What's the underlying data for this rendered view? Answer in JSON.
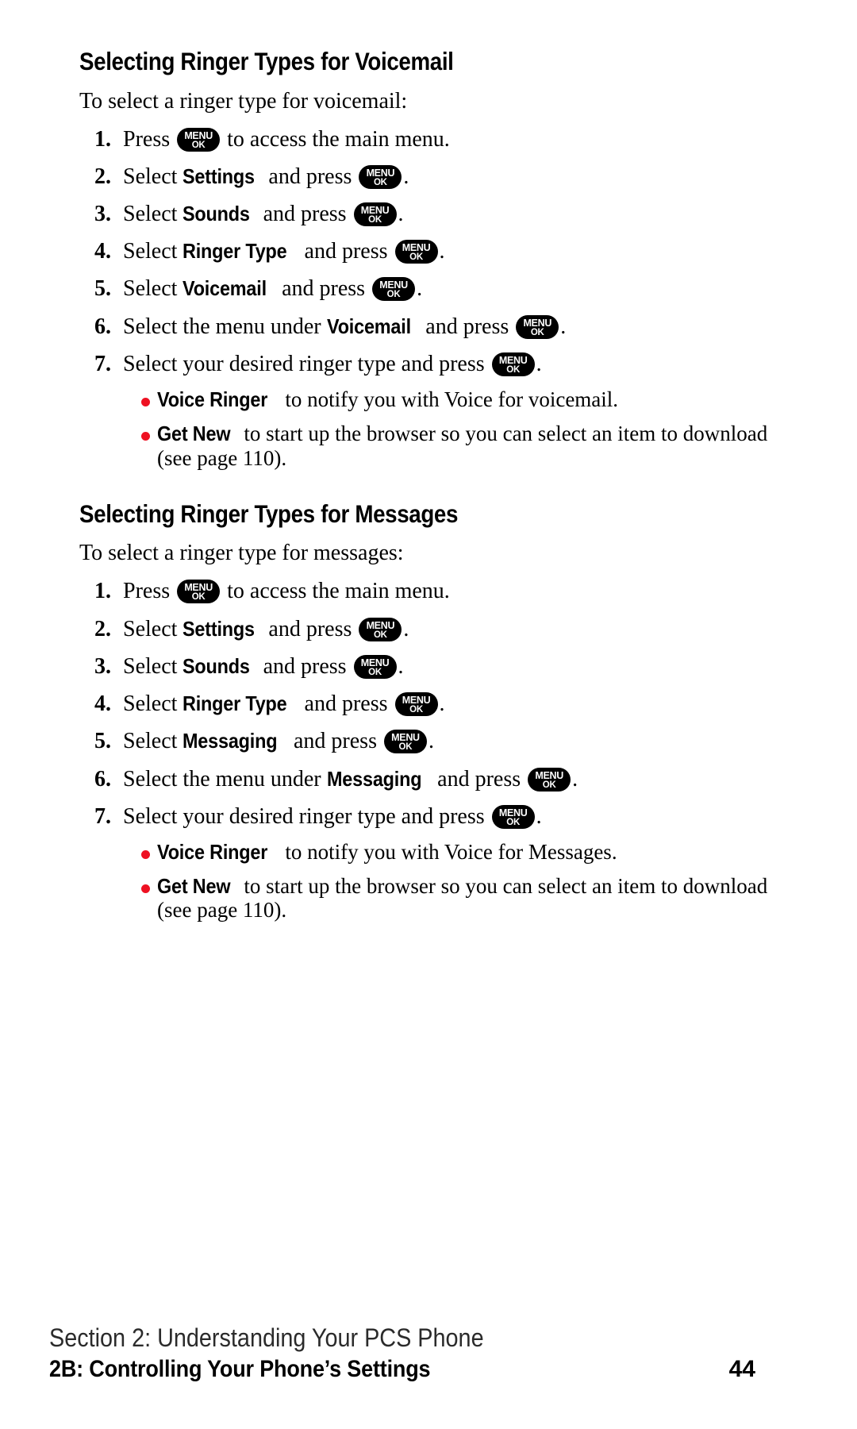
{
  "page": {
    "page_number": "44"
  },
  "sections": [
    {
      "heading": "Selecting Ringer Types for Voicemail",
      "lead_in": "To select a ringer type for voicemail:",
      "steps": [
        {
          "num": "1.",
          "pre": "Press ",
          "key": "MENU_OK",
          "post": " to access the main menu."
        },
        {
          "num": "2.",
          "pre": "Select ",
          "term": "Settings",
          "mid": " and press ",
          "key": "MENU_OK",
          "post": "."
        },
        {
          "num": "3.",
          "pre": "Select ",
          "term": "Sounds",
          "mid": " and press ",
          "key": "MENU_OK",
          "post": "."
        },
        {
          "num": "4.",
          "pre": "Select ",
          "term": "Ringer Type",
          "mid": " and press ",
          "key": "MENU_OK",
          "post": "."
        },
        {
          "num": "5.",
          "pre": "Select ",
          "term": "Voicemail",
          "mid": " and press ",
          "key": "MENU_OK",
          "post": "."
        },
        {
          "num": "6.",
          "pre": "Select the menu under ",
          "term": "Voicemail",
          "mid": " and press ",
          "key": "MENU_OK",
          "post": "."
        },
        {
          "num": "7.",
          "pre": "Select your desired ringer type and press ",
          "key": "MENU_OK",
          "post": "."
        }
      ],
      "subitems": [
        {
          "term": "Voice Ringer",
          "text": " to notify you with Voice for voicemail."
        },
        {
          "term": "Get New",
          "text": " to start up the browser so you can select an item to download (see page 110)."
        }
      ]
    },
    {
      "heading": "Selecting Ringer Types for Messages",
      "lead_in": "To select a ringer type for messages:",
      "steps": [
        {
          "num": "1.",
          "pre": "Press ",
          "key": "MENU_OK",
          "post": " to access the main menu."
        },
        {
          "num": "2.",
          "pre": "Select ",
          "term": "Settings",
          "mid": " and press ",
          "key": "MENU_OK",
          "post": "."
        },
        {
          "num": "3.",
          "pre": "Select ",
          "term": "Sounds",
          "mid": " and press ",
          "key": "MENU_OK",
          "post": "."
        },
        {
          "num": "4.",
          "pre": "Select ",
          "term": "Ringer Type",
          "mid": " and press ",
          "key": "MENU_OK",
          "post": "."
        },
        {
          "num": "5.",
          "pre": "Select ",
          "term": "Messaging",
          "mid": " and press ",
          "key": "MENU_OK",
          "post": "."
        },
        {
          "num": "6.",
          "pre": "Select the menu under ",
          "term": "Messaging",
          "mid": " and press ",
          "key": "MENU_OK",
          "post": "."
        },
        {
          "num": "7.",
          "pre": "Select your desired ringer type and press ",
          "key": "MENU_OK",
          "post": "."
        }
      ],
      "subitems": [
        {
          "term": "Voice Ringer",
          "text": " to notify you with Voice for Messages."
        },
        {
          "term": "Get New",
          "text": " to start up the browser so you can select an item to download (see page 110)."
        }
      ]
    }
  ],
  "menu_key": {
    "top_label": "MENU",
    "bottom_label": "OK"
  },
  "footer": {
    "section_line": "Section 2: Understanding Your PCS Phone",
    "chapter_line": "2B: Controlling Your Phone’s Settings",
    "page_number": "44"
  },
  "colors": {
    "bullet_red": "#ee1122",
    "text_black": "#000000",
    "page_background": "#ffffff"
  }
}
